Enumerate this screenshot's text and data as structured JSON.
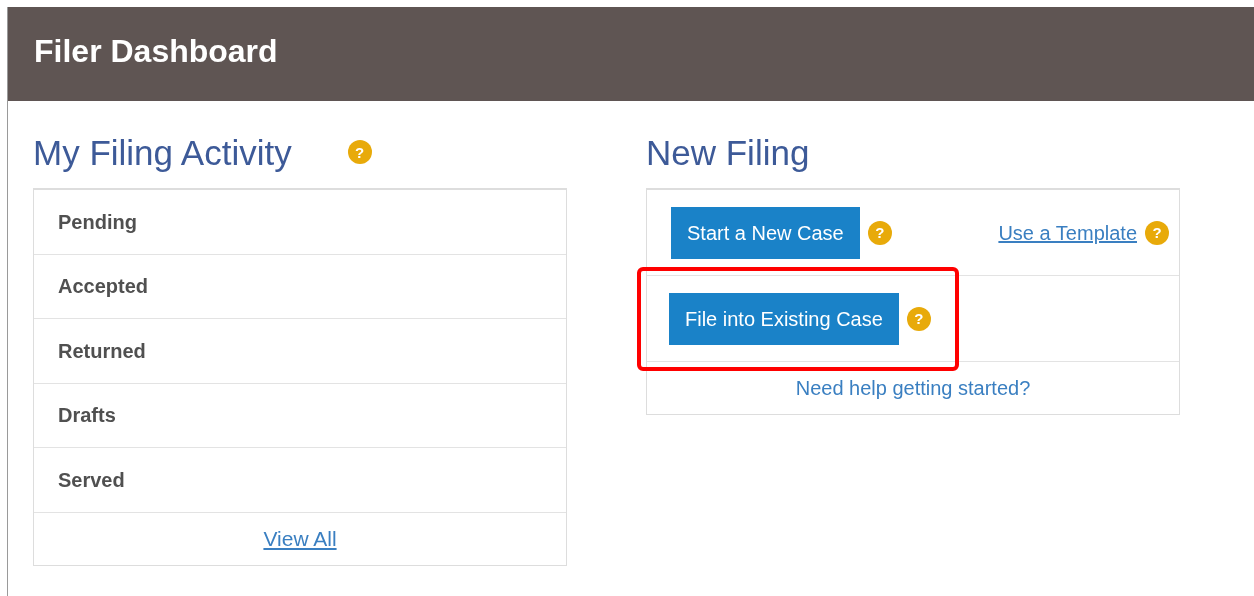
{
  "header": {
    "title": "Filer Dashboard"
  },
  "activity": {
    "title": "My Filing Activity",
    "help": "?",
    "items": [
      {
        "label": "Pending"
      },
      {
        "label": "Accepted"
      },
      {
        "label": "Returned"
      },
      {
        "label": "Drafts"
      },
      {
        "label": "Served"
      }
    ],
    "view_all": "View All"
  },
  "new_filing": {
    "title": "New Filing",
    "rows": [
      {
        "button": "Start a New Case",
        "help": "?",
        "link": "Use a Template",
        "link_help": "?",
        "highlighted": false
      },
      {
        "button": "File into Existing Case",
        "help": "?",
        "highlighted": true
      }
    ],
    "help_link": "Need help getting started?"
  }
}
